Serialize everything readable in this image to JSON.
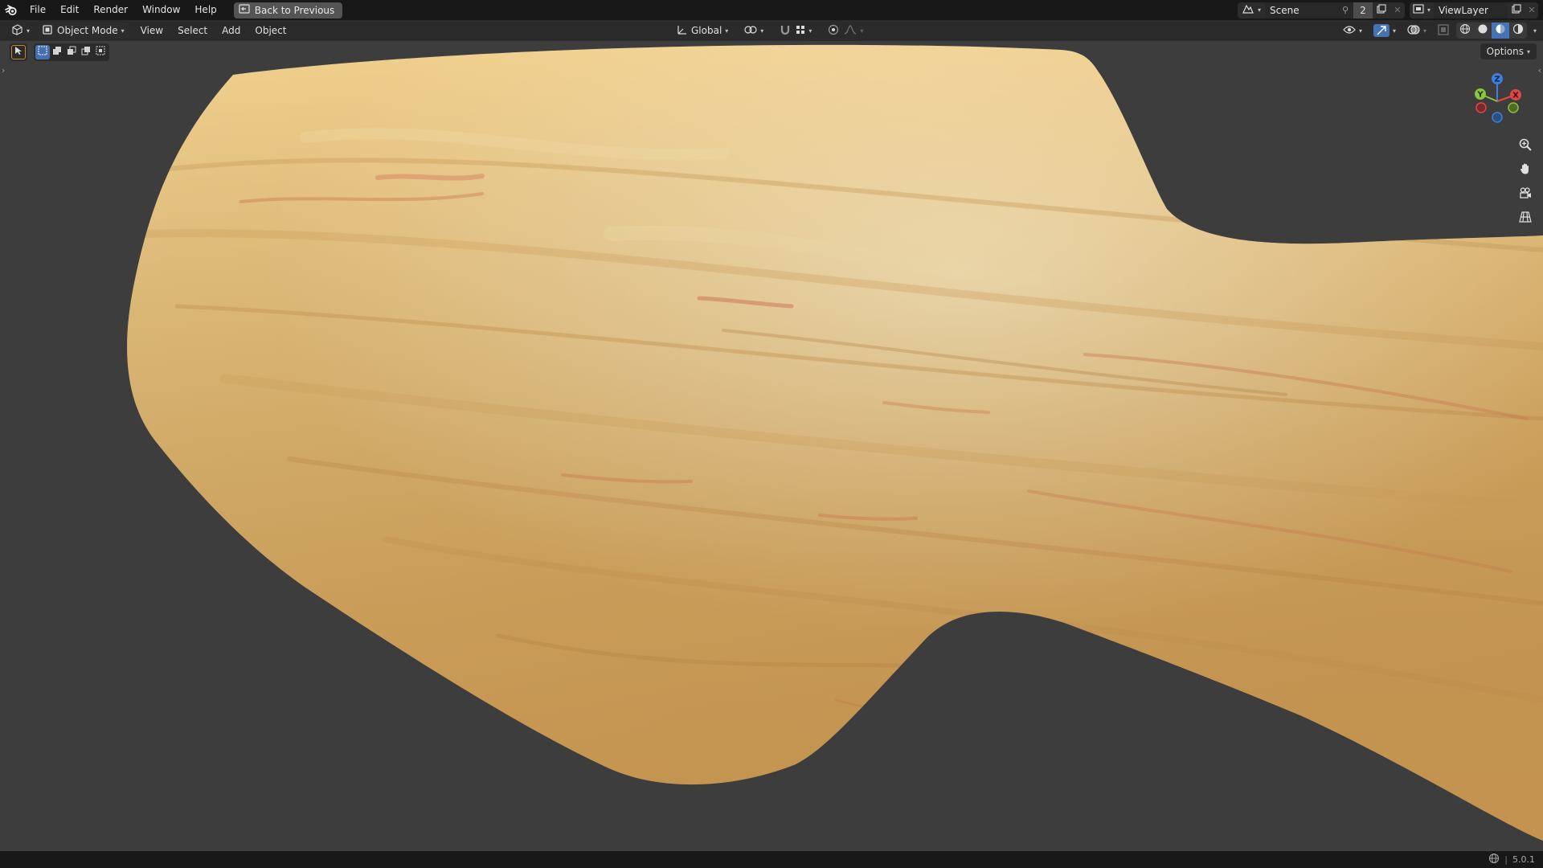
{
  "menubar": {
    "items": [
      "File",
      "Edit",
      "Render",
      "Window",
      "Help"
    ],
    "back_button": "Back to Previous",
    "scene_name": "Scene",
    "users_count": "2",
    "view_layer_name": "ViewLayer"
  },
  "header": {
    "mode_label": "Object Mode",
    "menus": [
      "View",
      "Select",
      "Add",
      "Object"
    ],
    "orientation_label": "Global"
  },
  "viewport": {
    "options_label": "Options",
    "gizmo_axes": {
      "x": "X",
      "y": "Y",
      "z": "Z"
    },
    "axis_colors": {
      "x": "#e04848",
      "y": "#8bc43f",
      "z": "#3b80e0"
    },
    "object_material": "wood",
    "background_color": "#3d3d3d"
  },
  "statusbar": {
    "version": "5.0.1"
  },
  "icons": {
    "logo": "blender-logo-icon",
    "back": "back-to-previous-icon",
    "editor_type": "3d-viewport-editor-icon",
    "zoom": "zoom-icon",
    "pan": "hand-pan-icon",
    "camera": "camera-view-icon",
    "ortho": "perspective-grid-icon"
  }
}
